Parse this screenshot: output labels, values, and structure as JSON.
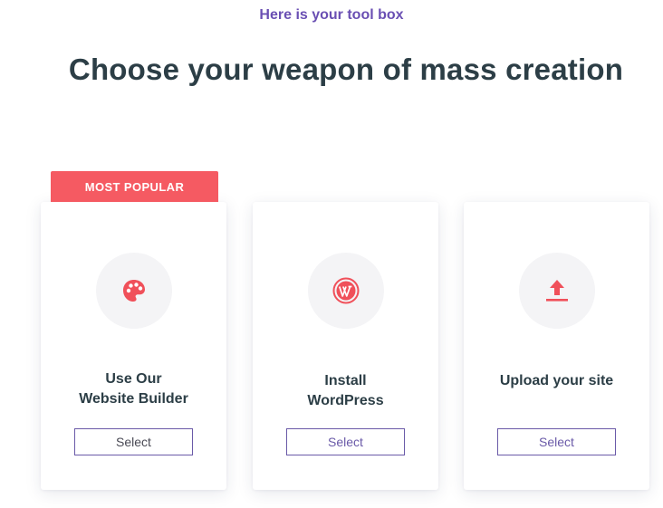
{
  "header": {
    "eyebrow": "Here is your tool box",
    "title": "Choose your weapon of mass creation"
  },
  "cards": [
    {
      "badge": "MOST POPULAR",
      "icon": "palette-icon",
      "title_line1": "Use Our",
      "title_line2": "Website Builder",
      "button_label": "Select"
    },
    {
      "icon": "wordpress-icon",
      "title_line1": "Install",
      "title_line2": "WordPress",
      "button_label": "Select"
    },
    {
      "icon": "upload-icon",
      "title_line1": "Upload your site",
      "button_label": "Select"
    }
  ],
  "colors": {
    "accent_purple": "#6a4fb3",
    "badge_red": "#f55a62",
    "icon_red": "#f0505a",
    "heading_dark": "#2c3e46"
  }
}
